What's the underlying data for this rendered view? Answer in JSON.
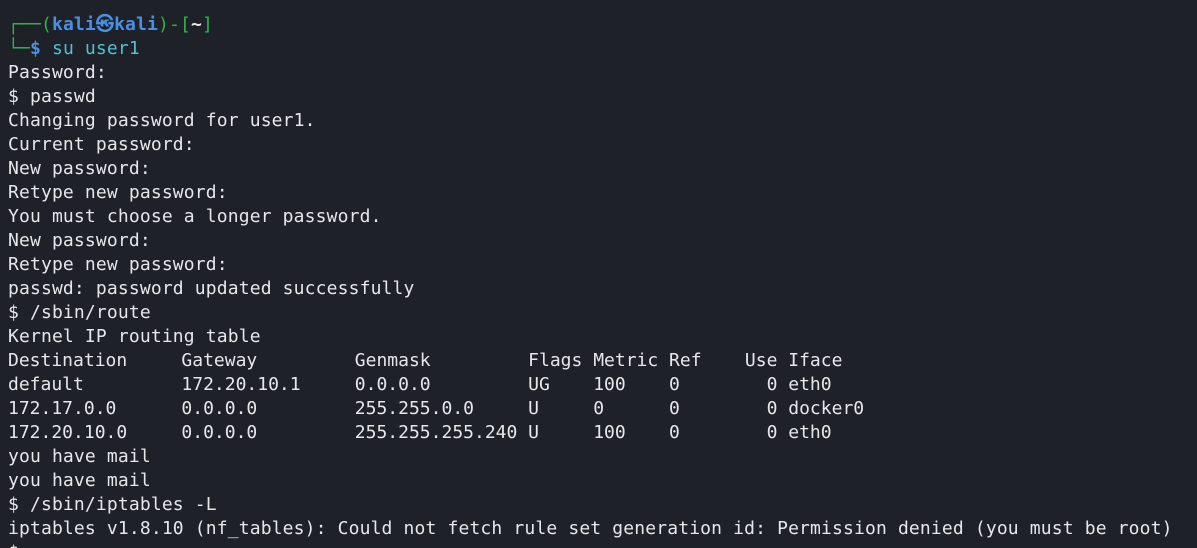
{
  "prompt": {
    "corner_top": "┌──(",
    "user": "kali",
    "skull": "㉿",
    "host": "kali",
    "mid": ")-[",
    "dir": "~",
    "end": "]",
    "corner_bottom": "└─",
    "dollar": "$ ",
    "command": "su user1"
  },
  "lines_before_route": [
    "Password:",
    "$ passwd",
    "Changing password for user1.",
    "Current password:",
    "New password:",
    "Retype new password:",
    "You must choose a longer password.",
    "New password:",
    "Retype new password:",
    "passwd: password updated successfully",
    "$ /sbin/route",
    "Kernel IP routing table"
  ],
  "route_table": {
    "header": "Destination     Gateway         Genmask         Flags Metric Ref    Use Iface",
    "rows": [
      "default         172.20.10.1     0.0.0.0         UG    100    0        0 eth0",
      "172.17.0.0      0.0.0.0         255.255.0.0     U     0      0        0 docker0",
      "172.20.10.0     0.0.0.0         255.255.255.240 U     100    0        0 eth0"
    ]
  },
  "lines_after_route": [
    "you have mail",
    "you have mail",
    "$ /sbin/iptables -L",
    "iptables v1.8.10 (nf_tables): Could not fetch rule set generation id: Permission denied (you must be root)",
    "$ "
  ]
}
